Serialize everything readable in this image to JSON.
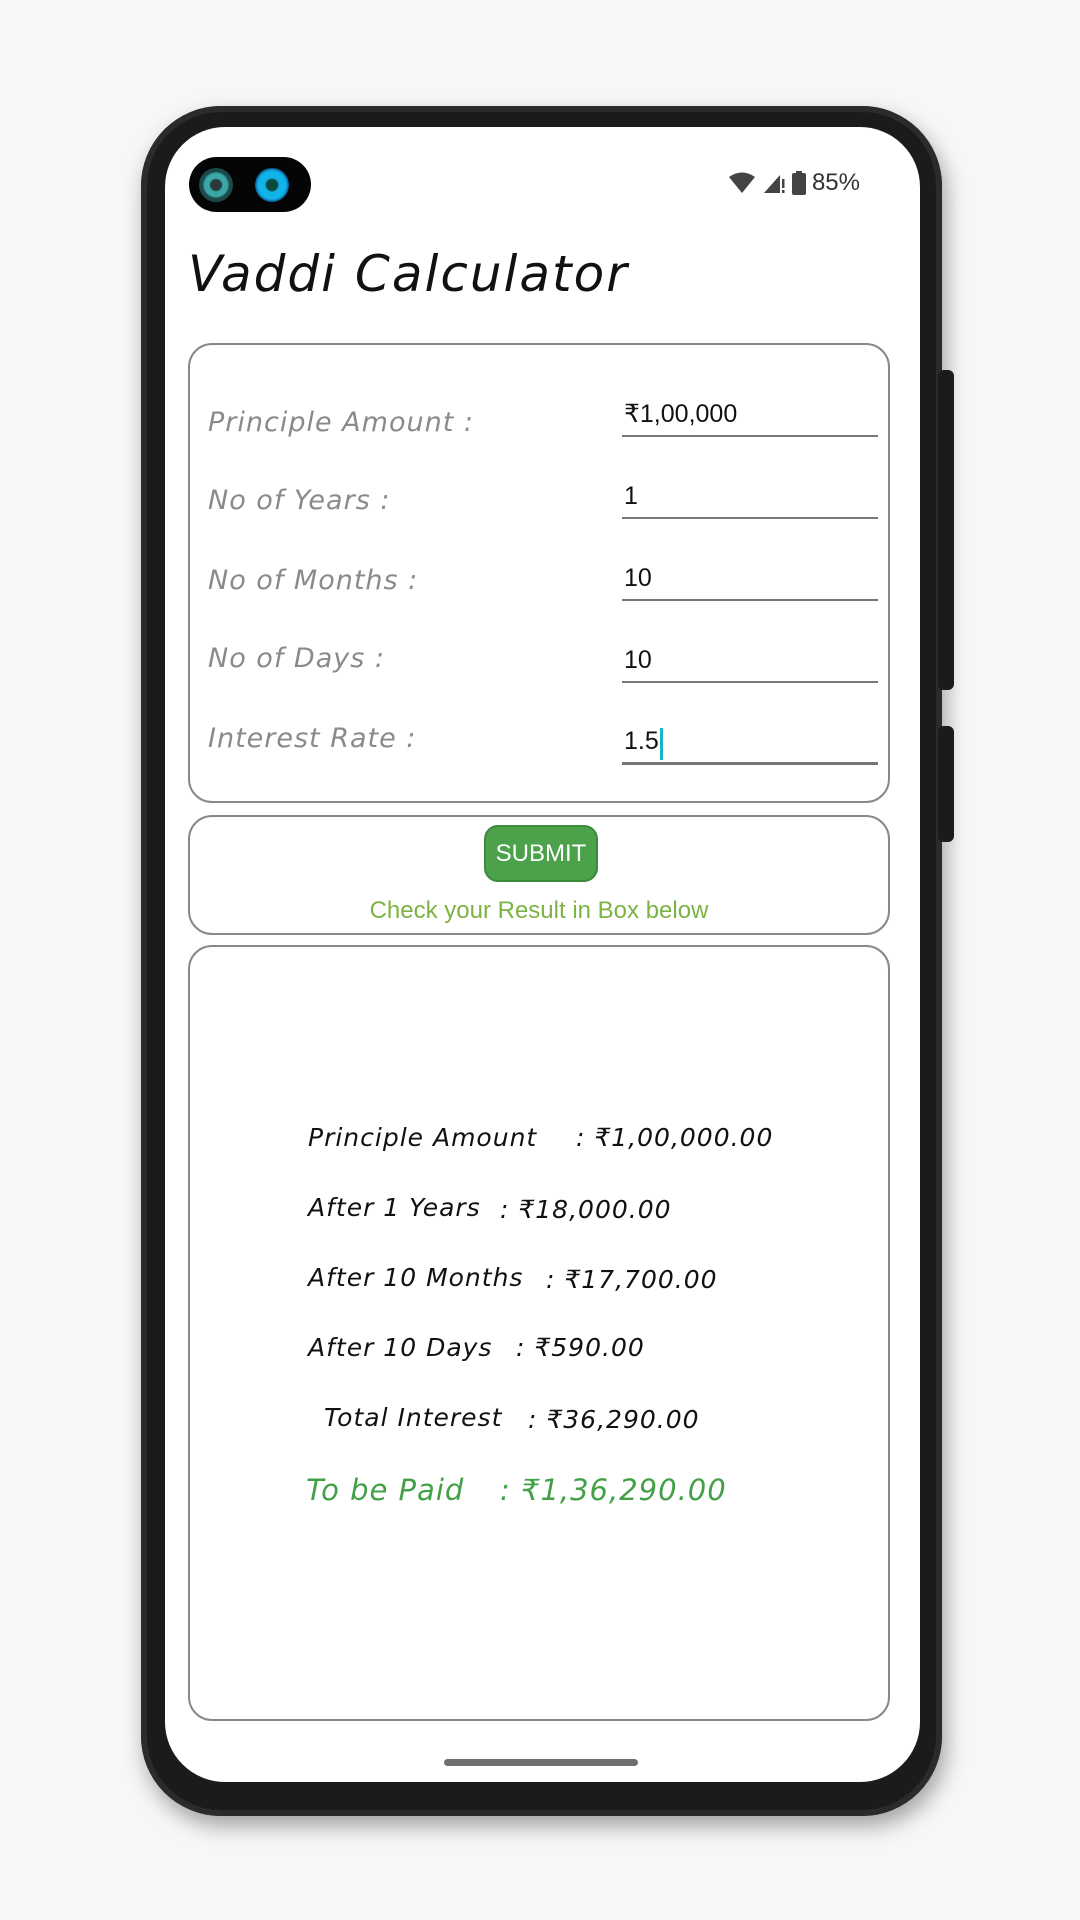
{
  "status": {
    "battery": "85%"
  },
  "app": {
    "title": "Vaddi Calculator"
  },
  "form": {
    "principle_label": "Principle Amount :",
    "principle_value": "₹1,00,000",
    "years_label": "No of Years :",
    "years_value": "1",
    "months_label": "No of Months :",
    "months_value": "10",
    "days_label": "No of Days :",
    "days_value": "10",
    "rate_label": "Interest Rate :",
    "rate_value": "1.5"
  },
  "action": {
    "submit_label": "SUBMIT",
    "hint": "Check your Result in Box below"
  },
  "result": {
    "principle_label": "Principle Amount",
    "principle_value": ": ₹1,00,000.00",
    "years_label": "After 1 Years",
    "years_value": ": ₹18,000.00",
    "months_label": "After 10  Months",
    "months_value": ": ₹17,700.00",
    "days_label": "After 10  Days",
    "days_value": ": ₹590.00",
    "total_label": "Total Interest",
    "total_value": ": ₹36,290.00",
    "paid_label": "To be Paid",
    "paid_value": ": ₹1,36,290.00"
  },
  "colors": {
    "accent_green": "#4ba24a",
    "hint_green": "#7cb342",
    "paid_green": "#43a047",
    "cursor": "#19b5c6"
  },
  "icons": [
    "wifi-icon",
    "signal-icon",
    "battery-icon"
  ]
}
